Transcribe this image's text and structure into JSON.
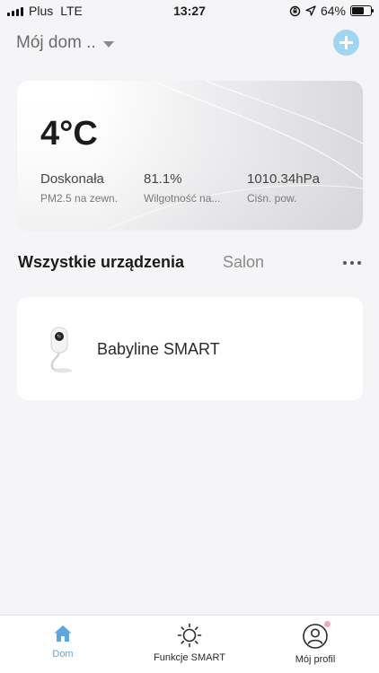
{
  "status_bar": {
    "carrier": "Plus",
    "network": "LTE",
    "time": "13:27",
    "battery": "64%",
    "battery_level": 0.64
  },
  "header": {
    "home_name": "Mój dom ..",
    "add_icon": "plus-icon",
    "accent_color": "#9fd6f4"
  },
  "weather": {
    "temperature": "4°C",
    "air_quality_value": "Doskonała",
    "air_quality_label": "PM2.5 na zewn.",
    "humidity_value": "81.1%",
    "humidity_label": "Wilgotność na...",
    "pressure_value": "1010.34hPa",
    "pressure_label": "Ciśn. pow."
  },
  "tabs": {
    "all_devices": "Wszystkie urządzenia",
    "room": "Salon",
    "more_icon": "more-horizontal-icon"
  },
  "devices": [
    {
      "name": "Babyline SMART",
      "icon": "camera-icon"
    }
  ],
  "bottom_nav": {
    "items": [
      {
        "label": "Dom",
        "icon": "home-icon",
        "active": true
      },
      {
        "label": "Funkcje SMART",
        "icon": "sun-icon",
        "active": false
      },
      {
        "label": "Mój profil",
        "icon": "profile-icon",
        "active": false
      }
    ],
    "active_color": "#5aa8e3"
  }
}
